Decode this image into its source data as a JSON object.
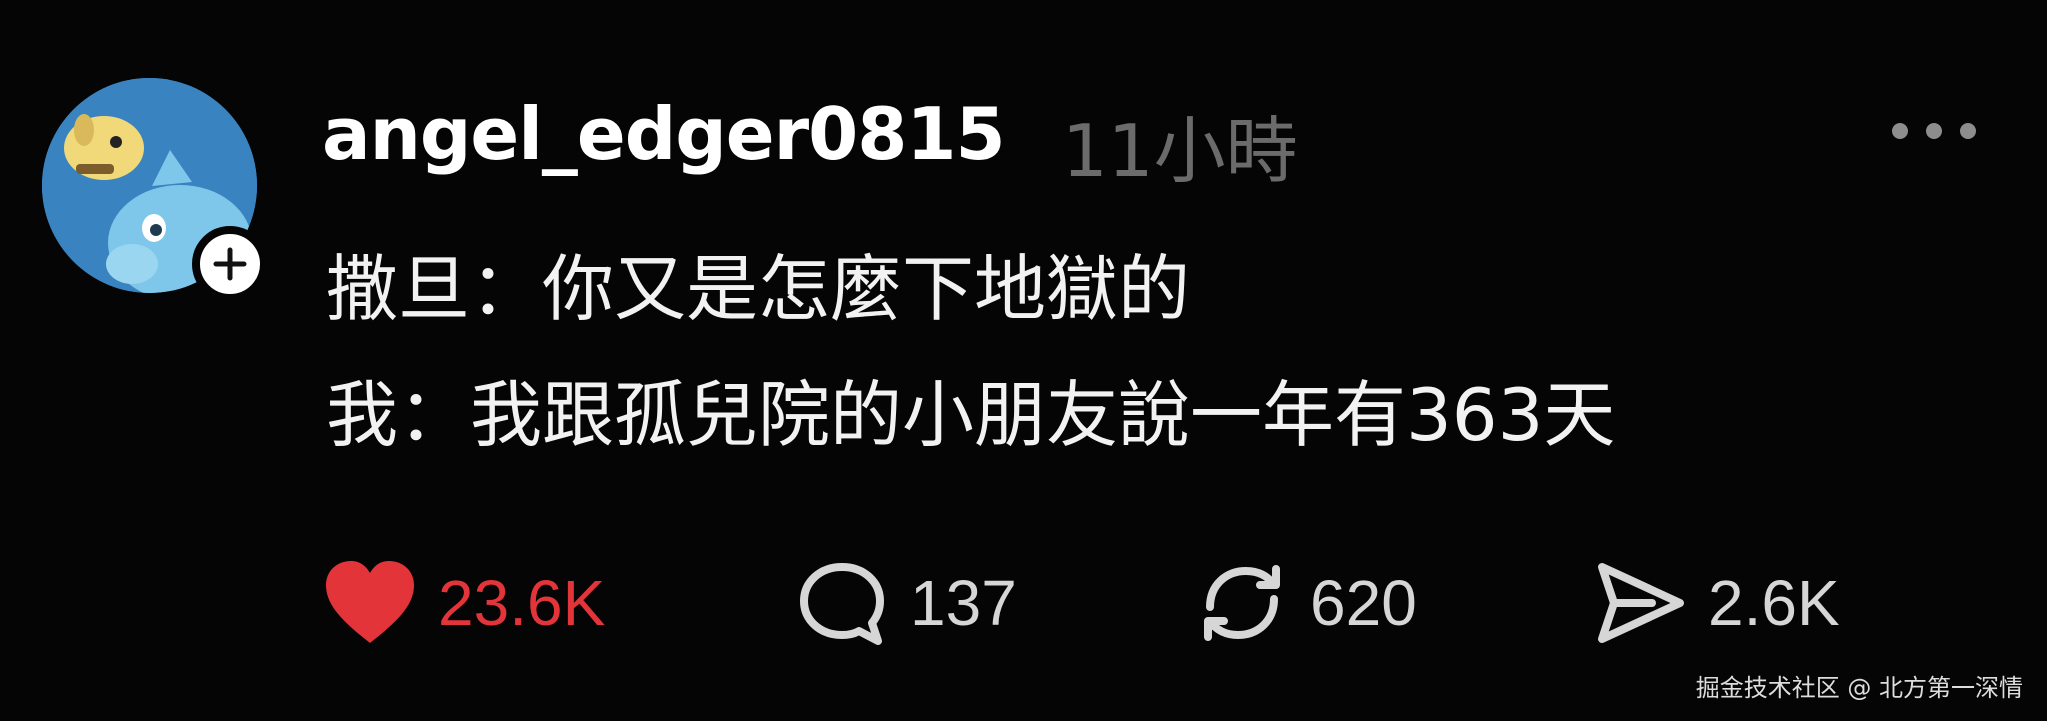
{
  "post": {
    "username": "angel_edger0815",
    "time_ago": "11小時",
    "body_lines": [
      "撒旦：你又是怎麼下地獄的",
      "我：我跟孤兒院的小朋友說一年有363天"
    ]
  },
  "avatar": {
    "icon": "cartoon-dog-avatar",
    "background_color": "#3a83c1",
    "follow_badge_icon": "plus-icon"
  },
  "actions": {
    "like": {
      "icon": "heart-icon",
      "count": "23.6K",
      "color": "#e3343a",
      "liked": true
    },
    "reply": {
      "icon": "speech-bubble-icon",
      "count": "137"
    },
    "repost": {
      "icon": "repost-icon",
      "count": "620"
    },
    "share": {
      "icon": "send-icon",
      "count": "2.6K"
    }
  },
  "menu": {
    "icon": "more-horizontal-icon"
  },
  "watermark": {
    "text": "掘金技术社区 @ 北方第一深情"
  },
  "theme": {
    "background": "#050505",
    "text": "#ffffff",
    "muted": "#6b6b6b"
  }
}
